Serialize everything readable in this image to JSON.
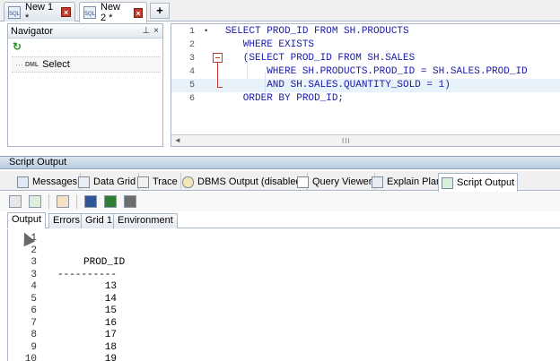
{
  "doc_tabs": [
    {
      "label": "New 1 *",
      "icon": "sql-file-icon",
      "icon_text": "SQL",
      "active": false
    },
    {
      "label": "New 2 *",
      "icon": "sql-file-icon",
      "icon_text": "SQL",
      "active": true
    }
  ],
  "add_tab_label": "+",
  "navigator": {
    "title": "Navigator",
    "pin_glyph": "⊥",
    "close_glyph": "×",
    "refresh_glyph": "↻",
    "tree_item_prefix": "DML",
    "tree_item_label": "Select"
  },
  "editor": {
    "lines": [
      {
        "num": "1",
        "marker": "•",
        "text": "SELECT PROD_ID FROM SH.PRODUCTS"
      },
      {
        "num": "2",
        "marker": "",
        "text": "   WHERE EXISTS"
      },
      {
        "num": "3",
        "marker": "",
        "text": "   (SELECT PROD_ID FROM SH.SALES"
      },
      {
        "num": "4",
        "marker": "",
        "text": "       WHERE SH.PRODUCTS.PROD_ID = SH.SALES.PROD_ID"
      },
      {
        "num": "5",
        "marker": "",
        "text": "       AND SH.SALES.QUANTITY_SOLD = 1)"
      },
      {
        "num": "6",
        "marker": "",
        "text": "   ORDER BY PROD_ID;"
      }
    ],
    "scroll_left_glyph": "◄",
    "scroll_grip": "III"
  },
  "script_output_title": "Script Output",
  "panel_tabs": [
    {
      "label": "Messages",
      "icon": "messages-icon",
      "color": "#dfe9f5"
    },
    {
      "label": "Data Grid",
      "icon": "data-grid-icon",
      "color": "#e9eef4"
    },
    {
      "label": "Trace",
      "icon": "trace-icon",
      "color": "#f2f2f2"
    },
    {
      "label": "DBMS Output (disabled)",
      "icon": "dbms-output-icon",
      "color": "#f5e6b8"
    },
    {
      "label": "Query Viewer",
      "icon": "query-viewer-icon",
      "color": "#ffffff"
    },
    {
      "label": "Explain Plan",
      "icon": "explain-plan-icon",
      "color": "#e7ecf2"
    },
    {
      "label": "Script Output",
      "icon": "script-output-icon",
      "color": "#d8f0d8",
      "active": true
    }
  ],
  "toolbar_icons": [
    "clear-icon",
    "filter-icon",
    "copy-icon",
    "save-icon",
    "excel-icon",
    "print-icon"
  ],
  "sub_tabs": [
    {
      "label": "Output",
      "active": true
    },
    {
      "label": "Errors"
    },
    {
      "label": "Grid 1"
    },
    {
      "label": "Environment"
    }
  ],
  "output": {
    "lines": [
      {
        "num": "1",
        "text": ""
      },
      {
        "num": "2",
        "text": ""
      },
      {
        "num": "3",
        "text": "PROD_ID"
      },
      {
        "num": "3",
        "text": "----------"
      },
      {
        "num": "4",
        "text": "        13"
      },
      {
        "num": "5",
        "text": "        14"
      },
      {
        "num": "6",
        "text": "        15"
      },
      {
        "num": "7",
        "text": "        16"
      },
      {
        "num": "8",
        "text": "        17"
      },
      {
        "num": "9",
        "text": "        18"
      },
      {
        "num": "10",
        "text": "        19"
      }
    ]
  }
}
